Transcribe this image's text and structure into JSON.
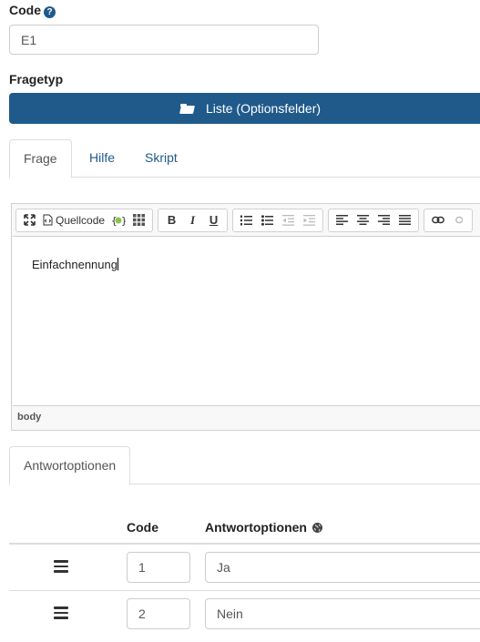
{
  "code_field": {
    "label": "Code",
    "value": "E1"
  },
  "question_type": {
    "label": "Fragetyp",
    "button_label": "Liste (Optionsfelder)"
  },
  "tabs": [
    {
      "label": "Frage",
      "active": true
    },
    {
      "label": "Hilfe",
      "active": false
    },
    {
      "label": "Skript",
      "active": false
    }
  ],
  "editor": {
    "toolbar": {
      "source_label": "Quellcode"
    },
    "content": "Einfachnennung",
    "path": "body"
  },
  "answer_tabs": [
    {
      "label": "Antwortoptionen",
      "active": true
    }
  ],
  "answers_table": {
    "headers": {
      "code": "Code",
      "options": "Antwortoptionen"
    },
    "rows": [
      {
        "code": "1",
        "text": "Ja"
      },
      {
        "code": "2",
        "text": "Nein"
      }
    ]
  },
  "colors": {
    "primary": "#1f5a8b",
    "link": "#1f5a8b",
    "border": "#dddddd"
  }
}
